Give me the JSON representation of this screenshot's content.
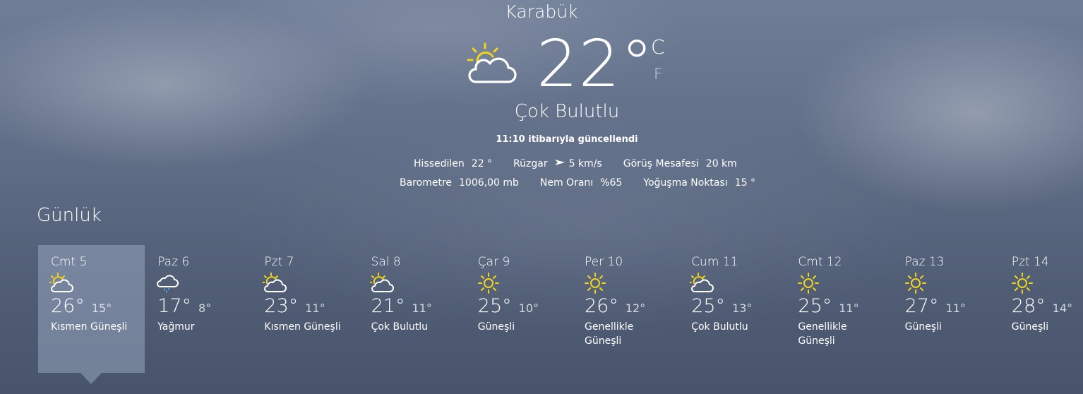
{
  "location": "Karabük",
  "current": {
    "temperature": "22°",
    "unit_c": "C",
    "unit_f": "F",
    "condition": "Çok Bulutlu",
    "updated": "11:10 itibarıyla güncellendi",
    "icon": "partly-cloudy-icon"
  },
  "details": {
    "feels_like_label": "Hissedilen",
    "feels_like_value": "22 °",
    "wind_label": "Rüzgar",
    "wind_value": "5 km/s",
    "visibility_label": "Görüş Mesafesi",
    "visibility_value": "20 km",
    "barometer_label": "Barometre",
    "barometer_value": "1006,00 mb",
    "humidity_label": "Nem Oranı",
    "humidity_value": "%65",
    "dewpoint_label": "Yoğuşma Noktası",
    "dewpoint_value": "15 °"
  },
  "daily_title": "Günlük",
  "days": [
    {
      "name": "Cmt 5",
      "icon": "partly-sunny-icon",
      "high": "26°",
      "low": "15°",
      "condition": "Kısmen Güneşli",
      "selected": true
    },
    {
      "name": "Paz 6",
      "icon": "rain-icon",
      "high": "17°",
      "low": "8°",
      "condition": "Yağmur"
    },
    {
      "name": "Pzt 7",
      "icon": "partly-sunny-icon",
      "high": "23°",
      "low": "11°",
      "condition": "Kısmen Güneşli"
    },
    {
      "name": "Sal 8",
      "icon": "partly-sunny-icon",
      "high": "21°",
      "low": "11°",
      "condition": "Çok Bulutlu"
    },
    {
      "name": "Çar 9",
      "icon": "sun-icon",
      "high": "25°",
      "low": "10°",
      "condition": "Güneşli"
    },
    {
      "name": "Per 10",
      "icon": "sun-icon",
      "high": "26°",
      "low": "12°",
      "condition": "Genellikle Güneşli"
    },
    {
      "name": "Cum 11",
      "icon": "partly-sunny-icon",
      "high": "25°",
      "low": "13°",
      "condition": "Çok Bulutlu"
    },
    {
      "name": "Cmt 12",
      "icon": "sun-icon",
      "high": "25°",
      "low": "11°",
      "condition": "Genellikle Güneşli"
    },
    {
      "name": "Paz 13",
      "icon": "sun-icon",
      "high": "27°",
      "low": "11°",
      "condition": "Güneşli"
    },
    {
      "name": "Pzt 14",
      "icon": "sun-icon",
      "high": "28°",
      "low": "14°",
      "condition": "Güneşli"
    }
  ],
  "colors": {
    "sun": "#f2d41a",
    "rain": "#5aa0e6",
    "text": "#ffffff"
  }
}
